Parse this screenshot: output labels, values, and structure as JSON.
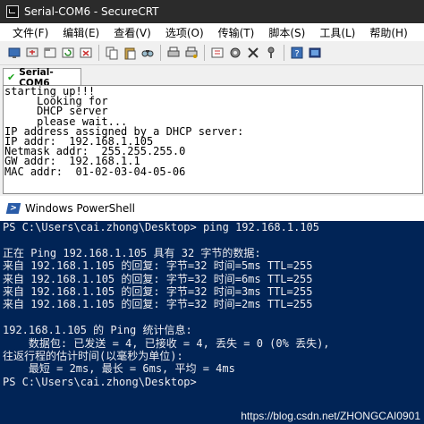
{
  "securecrt": {
    "title": "Serial-COM6 - SecureCRT",
    "menu": [
      "文件(F)",
      "编辑(E)",
      "查看(V)",
      "选项(O)",
      "传输(T)",
      "脚本(S)",
      "工具(L)",
      "帮助(H)"
    ],
    "toolbar_icons": [
      "connect-icon",
      "quick-connect-icon",
      "connect-tab-icon",
      "reconnect-icon",
      "disconnect-icon",
      "copy-icon",
      "paste-icon",
      "find-icon",
      "print-icon",
      "print-setup-icon",
      "session-options-icon",
      "global-options-icon",
      "keymap-icon",
      "sftp-icon",
      "help-icon",
      "about-icon"
    ],
    "tab_label": "Serial-COM6",
    "terminal_lines": [
      "starting up!!!",
      "     Looking for",
      "     DHCP server",
      "     please wait...",
      "IP address assigned by a DHCP server:",
      "IP addr:  192.168.1.105",
      "Netmask addr:  255.255.255.0",
      "GW addr:  192.168.1.1",
      "MAC addr:  01-02-03-04-05-06"
    ]
  },
  "powershell": {
    "title": "Windows PowerShell",
    "lines": [
      "PS C:\\Users\\cai.zhong\\Desktop> ping 192.168.1.105",
      "",
      "正在 Ping 192.168.1.105 具有 32 字节的数据:",
      "来自 192.168.1.105 的回复: 字节=32 时间=5ms TTL=255",
      "来自 192.168.1.105 的回复: 字节=32 时间=6ms TTL=255",
      "来自 192.168.1.105 的回复: 字节=32 时间=3ms TTL=255",
      "来自 192.168.1.105 的回复: 字节=32 时间=2ms TTL=255",
      "",
      "192.168.1.105 的 Ping 统计信息:",
      "    数据包: 已发送 = 4, 已接收 = 4, 丢失 = 0 (0% 丢失),",
      "往返行程的估计时间(以毫秒为单位):",
      "    最短 = 2ms, 最长 = 6ms, 平均 = 4ms",
      "PS C:\\Users\\cai.zhong\\Desktop>"
    ]
  },
  "watermark": "https://blog.csdn.net/ZHONGCAI0901"
}
